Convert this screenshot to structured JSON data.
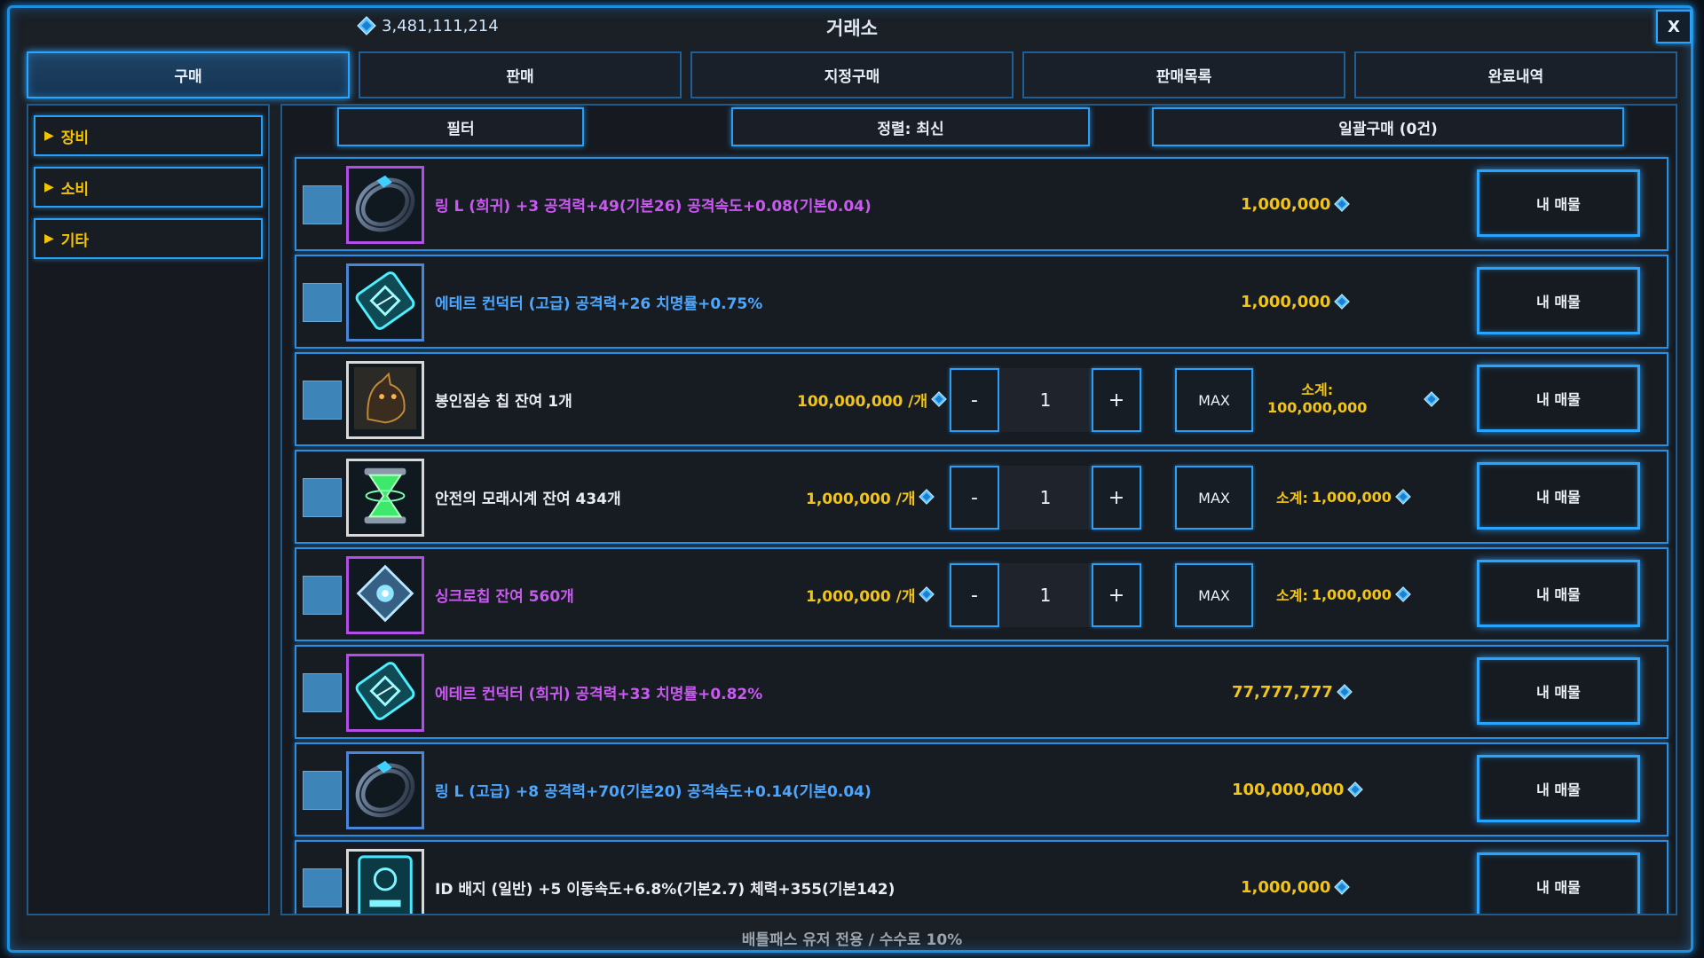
{
  "header": {
    "currency_value": "3,481,111,214",
    "title": "거래소",
    "close_label": "X"
  },
  "tabs": [
    {
      "label": "구매",
      "active": true
    },
    {
      "label": "판매",
      "active": false
    },
    {
      "label": "지정구매",
      "active": false
    },
    {
      "label": "판매목록",
      "active": false
    },
    {
      "label": "완료내역",
      "active": false
    }
  ],
  "sidebar": {
    "items": [
      {
        "label": "장비"
      },
      {
        "label": "소비"
      },
      {
        "label": "기타"
      }
    ]
  },
  "toolbar": {
    "filter_label": "필터",
    "sort_label": "정렬: 최신",
    "bulk_buy_label": "일괄구매 (0건)"
  },
  "items": [
    {
      "name": "링 L (희귀) +3  공격력+49(기본26) 공격속도+0.08(기본0.04)",
      "name_color": "purple",
      "icon": "ring-icon",
      "frame": "purple",
      "price": "1,000,000",
      "stackable": false,
      "button": "내 매물"
    },
    {
      "name": "에테르 컨덕터 (고급)  공격력+26 치명률+0.75%",
      "name_color": "blue",
      "icon": "ether-conductor-icon",
      "frame": "blue",
      "price": "1,000,000",
      "stackable": false,
      "button": "내 매물"
    },
    {
      "name": "봉인짐승 칩  잔여 1개",
      "name_color": "white",
      "icon": "sealed-beast-chip-icon",
      "frame": "white",
      "unit_price": "100,000,000 /개",
      "quantity": "1",
      "minus": "-",
      "plus": "+",
      "max": "MAX",
      "subtotal_label": "소계:",
      "subtotal_value": "100,000,000",
      "subtotal_stacked": true,
      "stackable": true,
      "button": "내 매물"
    },
    {
      "name": "안전의 모래시계  잔여 434개",
      "name_color": "white",
      "icon": "hourglass-icon",
      "frame": "white",
      "unit_price": "1,000,000 /개",
      "quantity": "1",
      "minus": "-",
      "plus": "+",
      "max": "MAX",
      "subtotal_label": "소계:",
      "subtotal_value": "1,000,000",
      "subtotal_stacked": false,
      "stackable": true,
      "button": "내 매물"
    },
    {
      "name": "싱크로칩  잔여 560개",
      "name_color": "purple",
      "icon": "synchro-chip-icon",
      "frame": "purple",
      "unit_price": "1,000,000 /개",
      "quantity": "1",
      "minus": "-",
      "plus": "+",
      "max": "MAX",
      "subtotal_label": "소계:",
      "subtotal_value": "1,000,000",
      "subtotal_stacked": false,
      "stackable": true,
      "button": "내 매물"
    },
    {
      "name": "에테르 컨덕터 (희귀)  공격력+33 치명률+0.82%",
      "name_color": "purple",
      "icon": "ether-conductor-icon",
      "frame": "purple",
      "price": "77,777,777",
      "stackable": false,
      "button": "내 매물"
    },
    {
      "name": "링 L (고급) +8  공격력+70(기본20) 공격속도+0.14(기본0.04)",
      "name_color": "blue",
      "icon": "ring-icon",
      "frame": "blue",
      "price": "100,000,000",
      "stackable": false,
      "button": "내 매물"
    },
    {
      "name": "ID 배지 (일반) +5  이동속도+6.8%(기본2.7) 체력+355(기본142)",
      "name_color": "white",
      "icon": "id-badge-icon",
      "frame": "white",
      "price": "1,000,000",
      "stackable": false,
      "button": "내 매물"
    }
  ],
  "footer": {
    "note": "배틀패스 유저 전용 / 수수료 10%"
  },
  "colors": {
    "accent": "#2aa5ff",
    "price": "#f2c418",
    "rare": "#c85af0",
    "advanced": "#4ea7ff"
  }
}
